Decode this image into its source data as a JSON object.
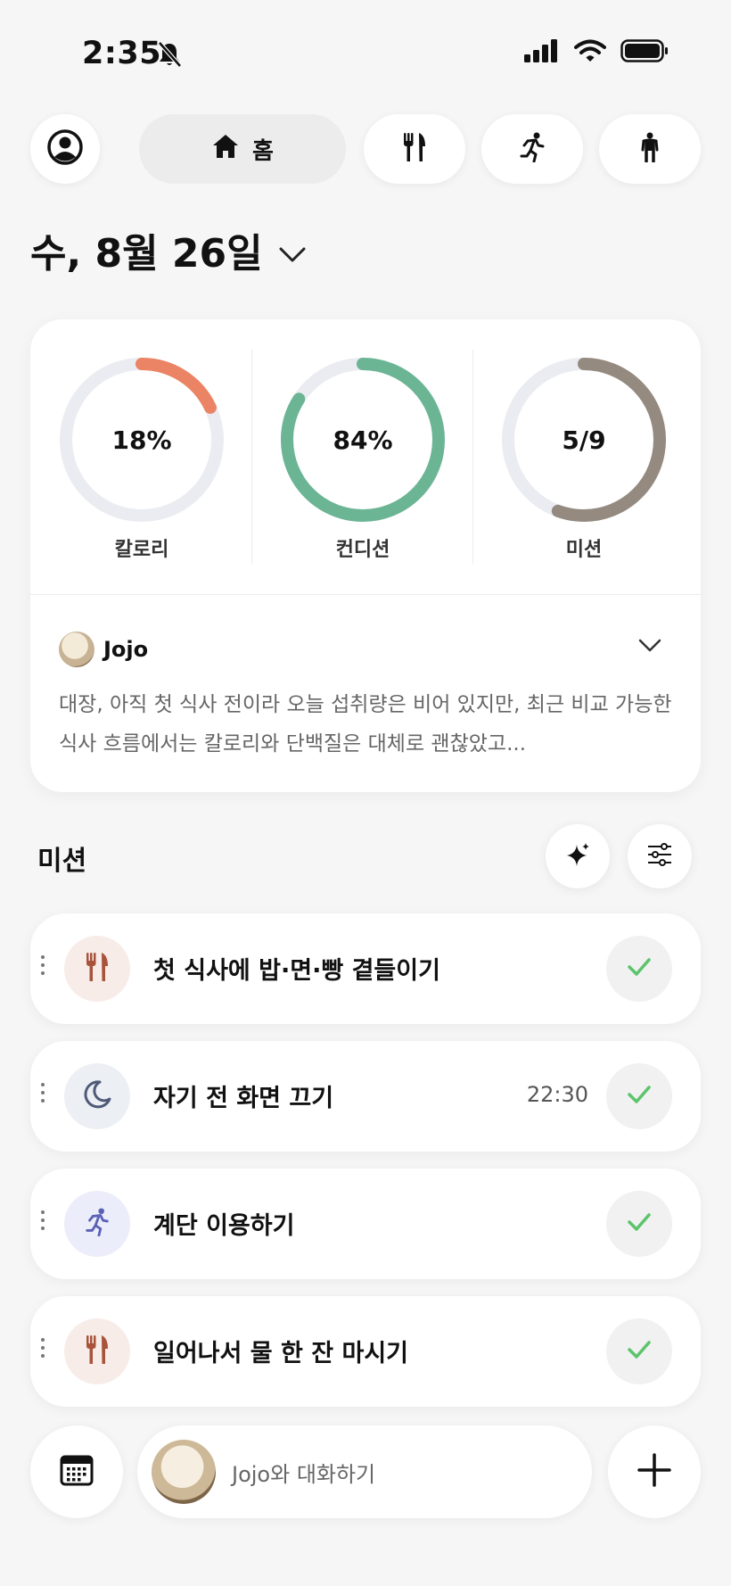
{
  "status_bar": {
    "time": "2:35",
    "icons": [
      "bell-slash-icon",
      "signal-icon",
      "wifi-icon",
      "battery-icon"
    ]
  },
  "nav": {
    "home_label": "홈",
    "items": [
      "profile-icon",
      "home-icon",
      "meal-icon",
      "run-icon",
      "body-icon"
    ]
  },
  "date": {
    "label": "수, 8월 26일"
  },
  "summary": {
    "rings": [
      {
        "value_text": "18%",
        "label": "칼로리",
        "fraction": 0.18,
        "color": "#ea8465"
      },
      {
        "value_text": "84%",
        "label": "컨디션",
        "fraction": 0.84,
        "color": "#6bb595"
      },
      {
        "value_text": "5/9",
        "label": "미션",
        "fraction": 0.5556,
        "color": "#948a80"
      }
    ],
    "coach": {
      "name": "Jojo",
      "message": "대장, 아직 첫 식사 전이라 오늘 섭취량은 비어 있지만, 최근 비교 가능한 식사 흐름에서는 칼로리와 단백질은 대체로 괜찮았고..."
    }
  },
  "missions": {
    "title": "미션",
    "items": [
      {
        "label": "첫 식사에 밥·면·빵 곁들이기",
        "time": "",
        "icon": "fork-knife-icon",
        "done": true
      },
      {
        "label": "자기 전 화면 끄기",
        "time": "22:30",
        "icon": "moon-icon",
        "done": true
      },
      {
        "label": "계단 이용하기",
        "time": "",
        "icon": "run-icon",
        "done": true
      },
      {
        "label": "일어나서 물 한 잔 마시기",
        "time": "",
        "icon": "fork-knife-icon",
        "done": true
      }
    ]
  },
  "bottom": {
    "chat_placeholder": "Jojo와 대화하기"
  },
  "colors": {
    "check": "#5cc46b",
    "meal_icon": "#a8543c",
    "sleep_icon": "#4e5a78",
    "walk_icon": "#5a62b8"
  }
}
